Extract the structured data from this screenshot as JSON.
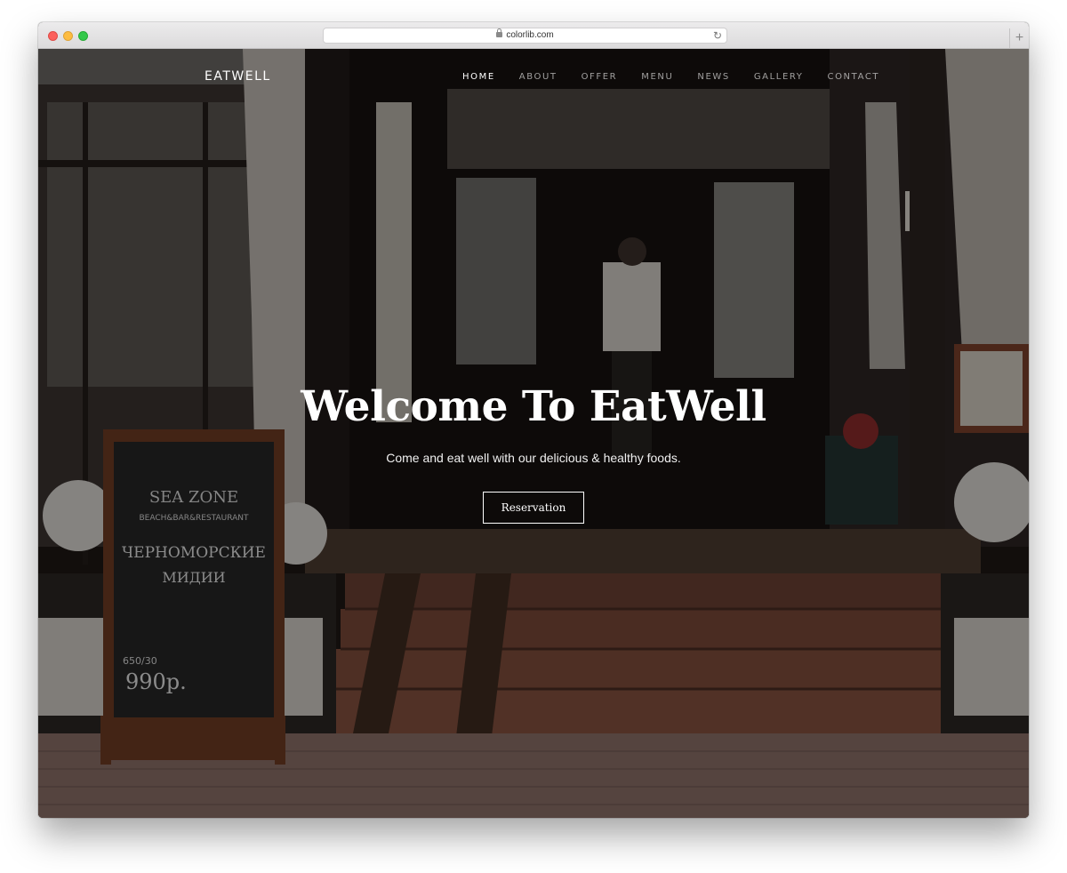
{
  "browser": {
    "url": "colorlib.com"
  },
  "site": {
    "brand": "EATWELL",
    "nav": [
      "HOME",
      "ABOUT",
      "OFFER",
      "MENU",
      "NEWS",
      "GALLERY",
      "CONTACT"
    ],
    "active_nav": "HOME"
  },
  "hero": {
    "title": "Welcome To EatWell",
    "subtitle": "Come and eat well with our delicious & healthy foods.",
    "button_label": "Reservation"
  },
  "sign": {
    "line1": "SEA ZONE",
    "line2": "BEACH&BAR&RESTAURANT",
    "line3": "ЧЕРНОМОРСКИЕ",
    "line4": "МИДИИ",
    "weight": "650/30",
    "price": "990р."
  }
}
